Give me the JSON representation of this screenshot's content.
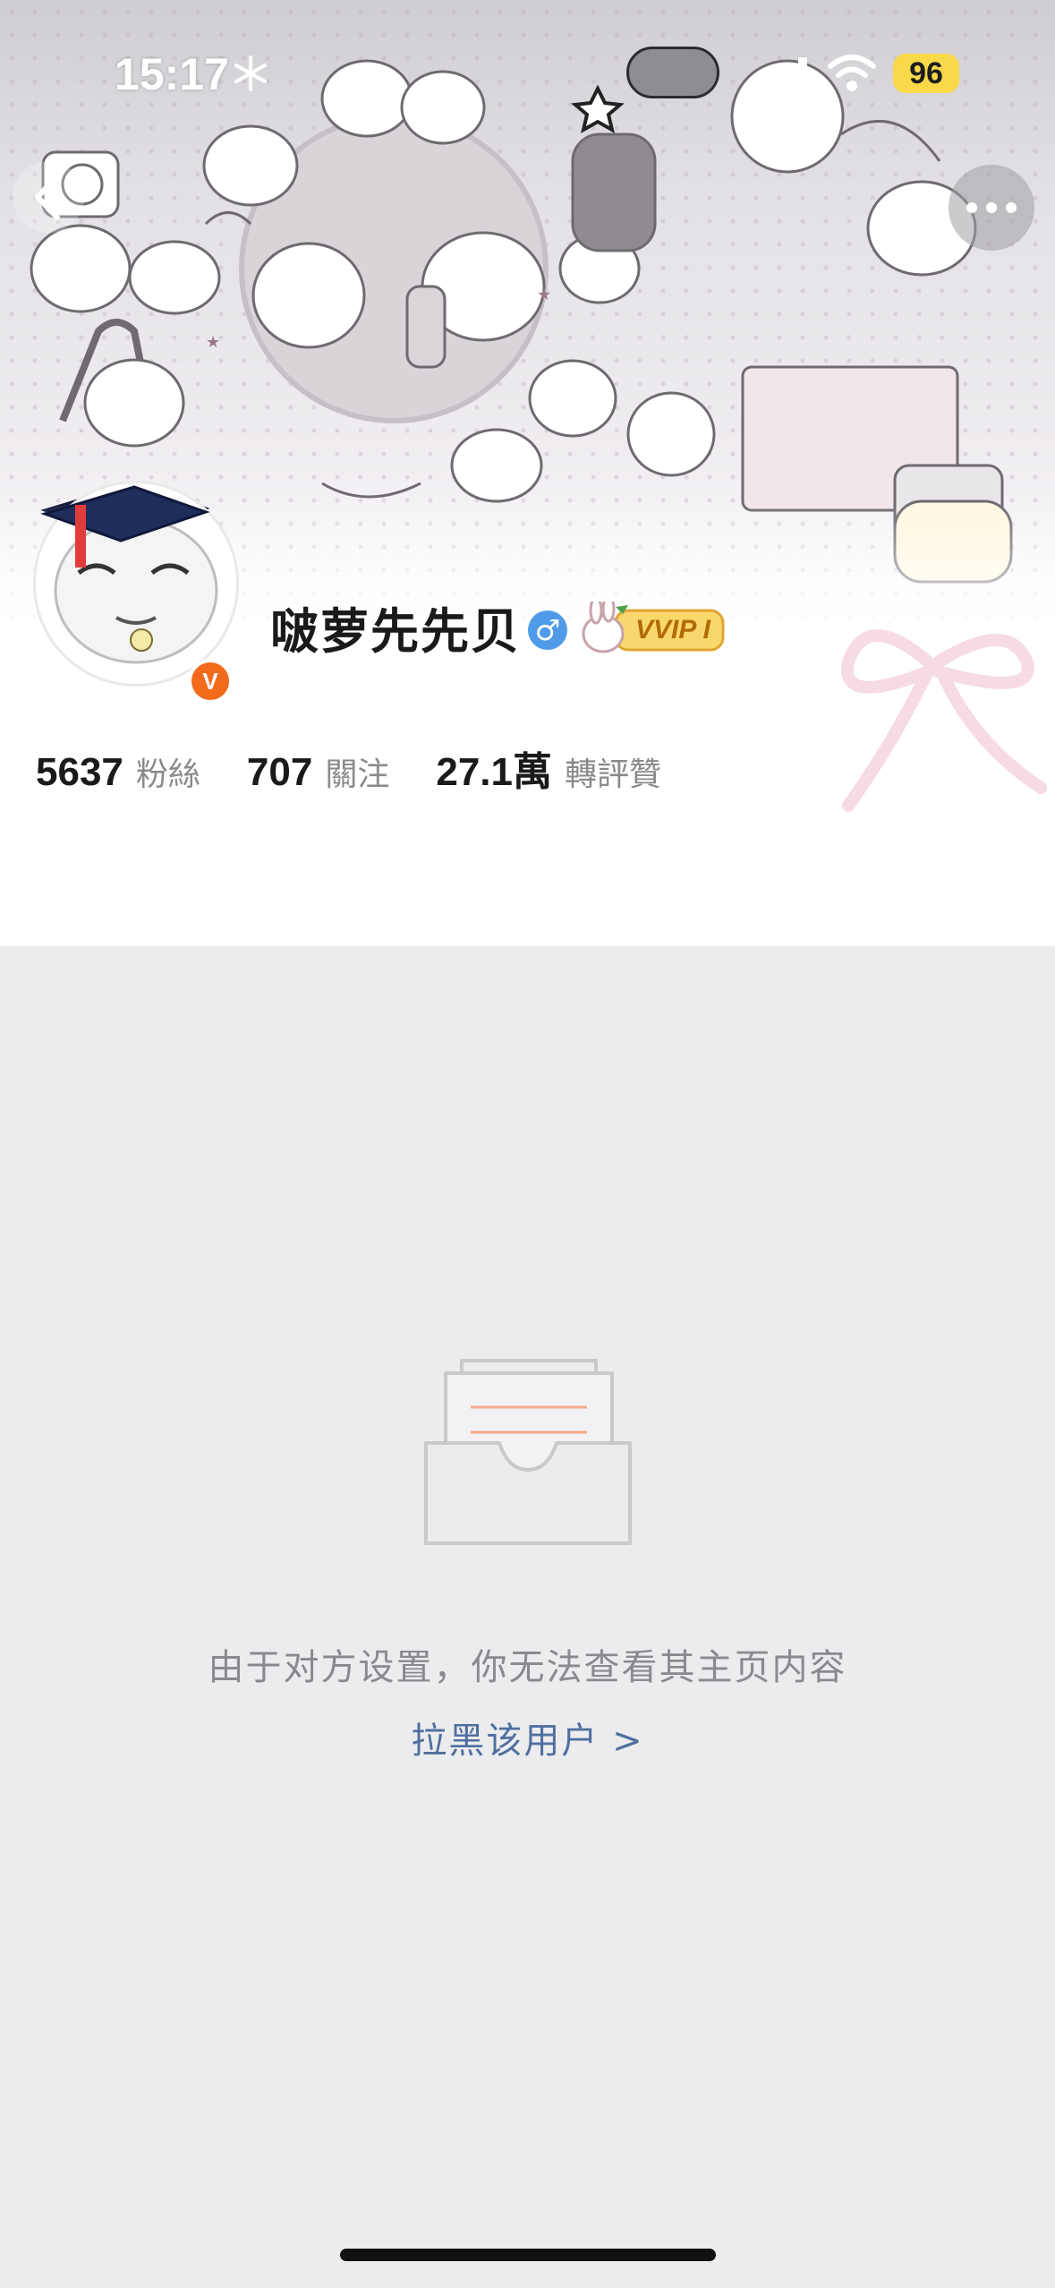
{
  "status_bar": {
    "time": "15:17",
    "battery": "96"
  },
  "profile": {
    "name": "啵萝先先贝",
    "vip_label": "VVIP I",
    "verified_badge": "V"
  },
  "stats": [
    {
      "value": "5637",
      "label": "粉絲"
    },
    {
      "value": "707",
      "label": "關注"
    },
    {
      "value": "27.1萬",
      "label": "轉評贊"
    }
  ],
  "empty_state": {
    "message": "由于对方设置，你无法查看其主页内容",
    "block_link": "拉黑该用户 >"
  },
  "icons": {
    "back": "back-chevron-icon",
    "more": "more-dots-icon",
    "gender": "male-icon",
    "empty": "empty-inbox-icon"
  },
  "colors": {
    "link": "#4f6f9f",
    "verified": "#f26b1d",
    "gender": "#4f9be8",
    "battery": "#f9d94a"
  }
}
